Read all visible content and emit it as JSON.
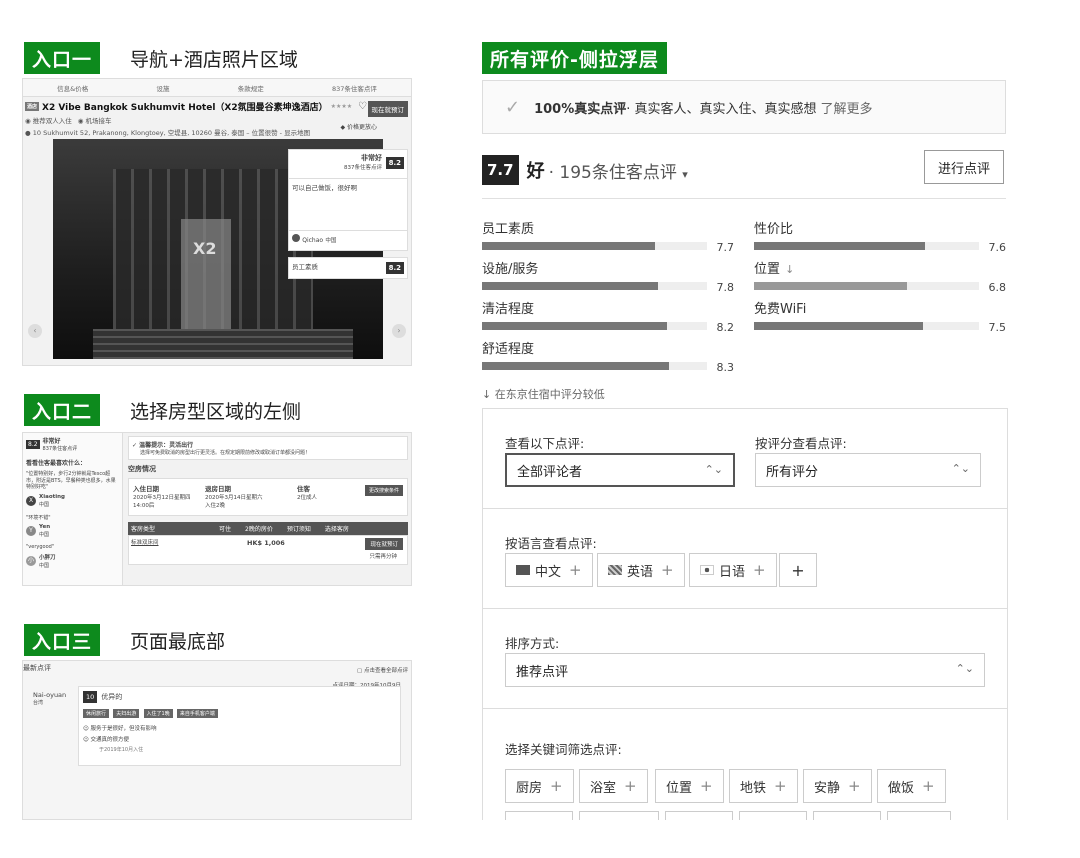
{
  "entries": {
    "entry1": {
      "tag": "入口一",
      "desc": "导航+酒店照片区域"
    },
    "entry2": {
      "tag": "入口二",
      "desc": "选择房型区域的左侧"
    },
    "entry3": {
      "tag": "入口三",
      "desc": "页面最底部"
    }
  },
  "panel_tag": "所有评价-侧拉浮层",
  "shot1": {
    "nav": [
      "信息&价格",
      "设施",
      "条款规定",
      "837条住客点评"
    ],
    "badge": "酒店",
    "hotel_name": "X2 Vibe Bangkok Sukhumvit Hotel（X2氛围曼谷素坤逸酒店）",
    "stars": "★★★★",
    "book_btn": "现在就预订",
    "price_promise": "价格更放心",
    "tags": [
      "推荐双人入住",
      "机场接车"
    ],
    "address": "10 Sukhumvit 52, Prakanong, Klongtoey, 空堤县, 10260 曼谷, 泰国 – 位置很赞 - 显示地图",
    "photo_text": "X2",
    "rating_word": "非常好",
    "rating_count": "837条住客点评",
    "rating": "8.2",
    "quote": "可以自己做饭，很好啊",
    "reviewer": "Qichao",
    "reviewer_country": "中国",
    "staff_label": "员工素质",
    "staff_score": "8.2"
  },
  "shot2": {
    "score": "8.2",
    "score_word": "非常好",
    "score_count": "837条住客点评",
    "question": "看看住客最喜欢什么：",
    "quote1": "\"位置特别好，步行2分钟就是Tesco超市，附近是BTS，早餐种类也很多，水果特别好吃\"",
    "user1": "Xiaoting",
    "user1_country": "中国",
    "quote2": "\"环境不错\"",
    "user2": "Yen",
    "user2_country": "中国",
    "quote3": "\"verygood\"",
    "user3": "小胖刀",
    "user3_country": "中国",
    "tip_title": "温馨提示：灵活出行",
    "tip_text": "选择可免费取消的房型出行更灵活。在规定期限前修改或取消订单都没问题！",
    "section": "空房情况",
    "checkin_label": "入住日期",
    "checkin": "2020年3月12日星期四 14:00后",
    "checkout_label": "退房日期",
    "checkout": "2020年3月14日星期六 入住2晚",
    "guests_label": "住客",
    "guests": "2位成人",
    "change_btn": "更改搜索条件",
    "headers": [
      "客房类型",
      "可住",
      "2晚的房价",
      "预订须知",
      "选择客房"
    ],
    "room": "标准双床间",
    "price": "HK$ 1,006",
    "reserve_btn": "现在就预订",
    "note": "只需再分钟"
  },
  "shot3": {
    "title": "最新点评",
    "link": "点击查看全部点评",
    "date": "点评日期：2019年10月9日",
    "user": "Nai-oyuan",
    "user_country": "台湾",
    "score": "10",
    "score_word": "优异的",
    "chips": [
      "休闲旅行",
      "夫妇出游",
      "入住了1晚",
      "来自手机客户端"
    ],
    "line1": "服务于是很好，但没有影响",
    "line2": "交通真的很方便",
    "footer": "于2019年10月入住"
  },
  "verify": {
    "bold": "100%真实点评",
    "text": " · 真实客人、真实入住、真实感想",
    "more": "了解更多"
  },
  "overall": {
    "score": "7.7",
    "word": "好",
    "count": "· 195条住客点评",
    "write_btn": "进行点评"
  },
  "metrics": [
    {
      "name": "员工素质",
      "value": 7.7,
      "display": "7.7",
      "low": false
    },
    {
      "name": "性价比",
      "value": 7.6,
      "display": "7.6",
      "low": false
    },
    {
      "name": "设施/服务",
      "value": 7.8,
      "display": "7.8",
      "low": false
    },
    {
      "name": "位置",
      "value": 6.8,
      "display": "6.8",
      "low": true
    },
    {
      "name": "清洁程度",
      "value": 8.2,
      "display": "8.2",
      "low": false
    },
    {
      "name": "免费WiFi",
      "value": 7.5,
      "display": "7.5",
      "low": false
    },
    {
      "name": "舒适程度",
      "value": 8.3,
      "display": "8.3",
      "low": false
    }
  ],
  "lower_note": "↓ 在东京住宿中评分较低",
  "filters": {
    "reviewer_label": "查看以下点评:",
    "reviewer_value": "全部评论者",
    "score_label": "按评分查看点评:",
    "score_value": "所有评分",
    "lang_label": "按语言查看点评:",
    "langs": [
      "中文",
      "英语",
      "日语"
    ],
    "lang_plus": "+",
    "sort_label": "排序方式:",
    "sort_value": "推荐点评",
    "keyword_label": "选择关键词筛选点评:",
    "keywords": [
      "厨房",
      "浴室",
      "位置",
      "地铁",
      "安静",
      "做饭"
    ]
  },
  "colors": {
    "brand_green": "#0d8a1d",
    "bar_fill": "#777777",
    "low_fill": "#999999"
  }
}
